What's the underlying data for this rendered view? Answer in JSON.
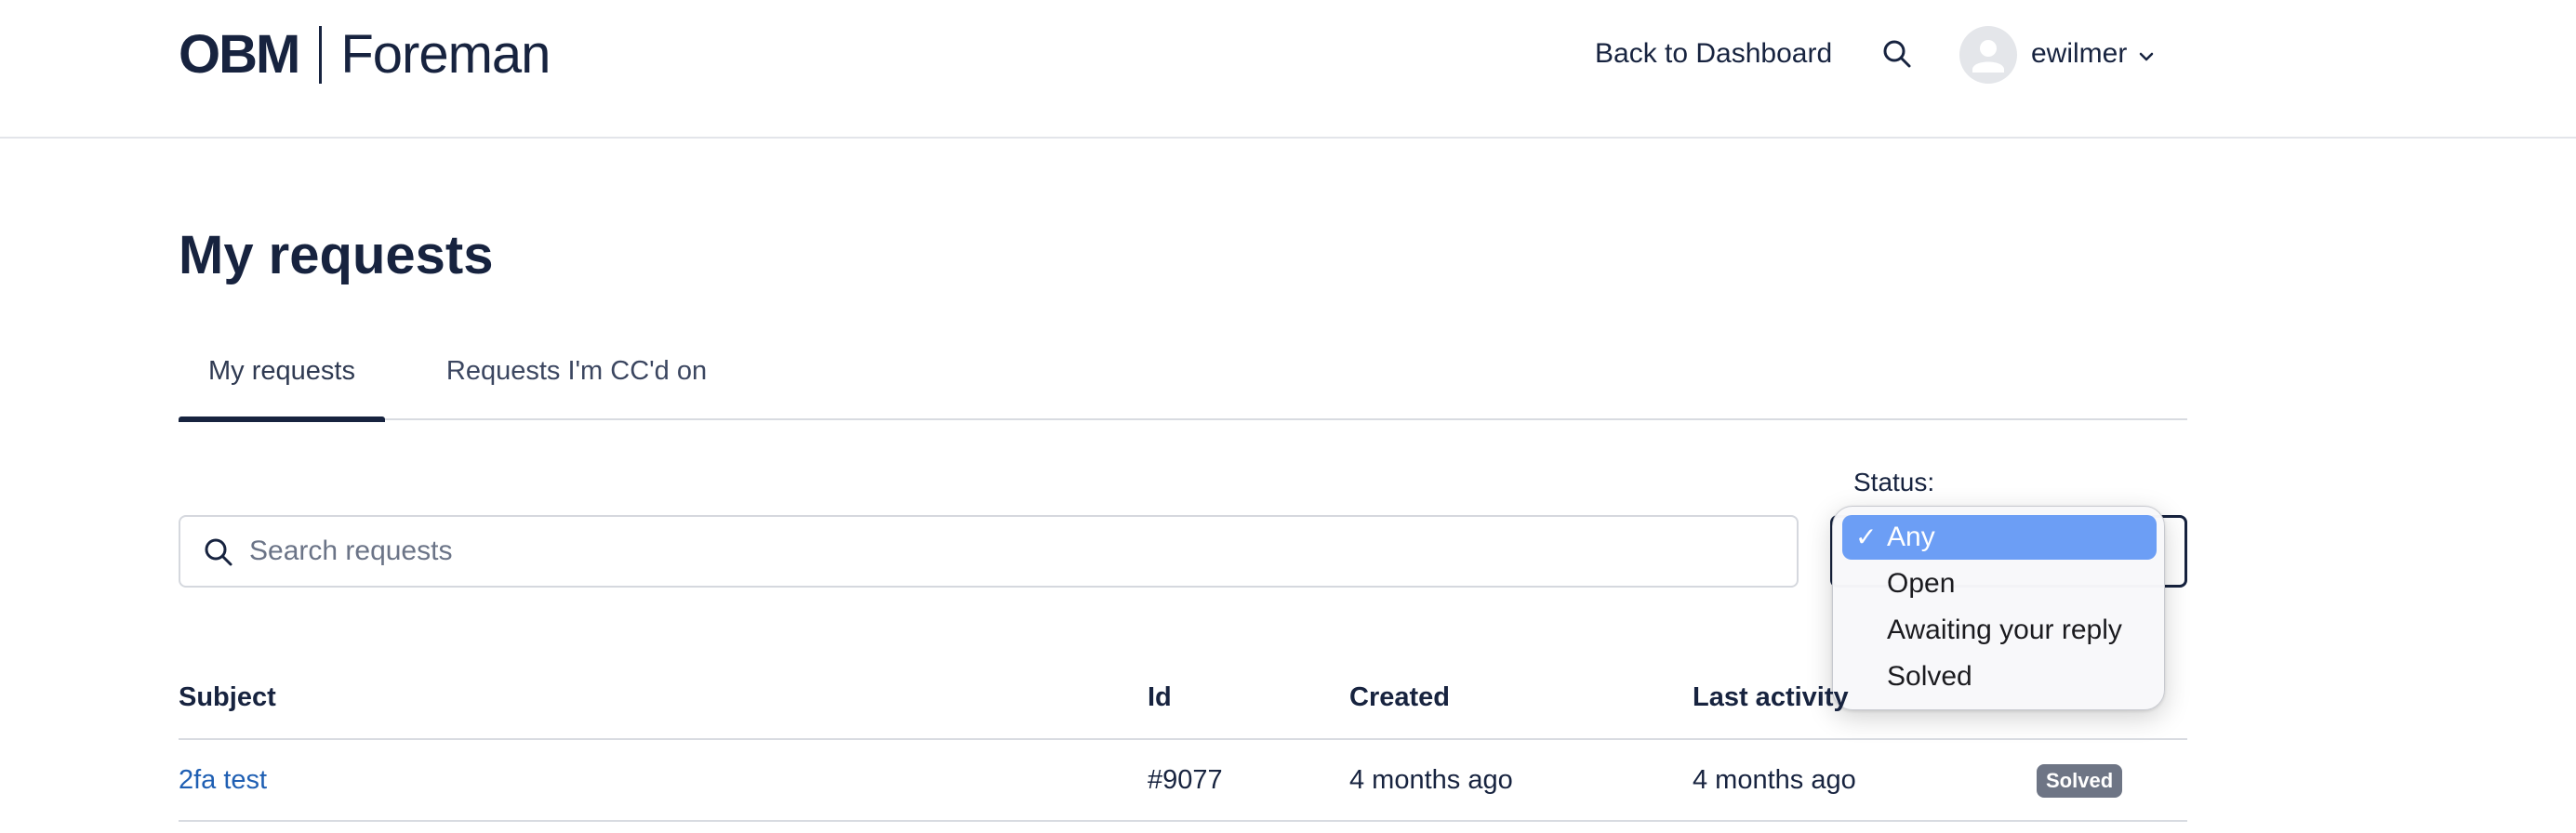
{
  "header": {
    "logo_left": "OBM",
    "logo_right": "Foreman",
    "back_link": "Back to Dashboard",
    "search_icon": "search-icon",
    "avatar_icon": "user-avatar-icon",
    "username": "ewilmer",
    "user_chevron_icon": "chevron-down-icon"
  },
  "page": {
    "title": "My requests"
  },
  "tabs": [
    {
      "label": "My requests",
      "active": true
    },
    {
      "label": "Requests I'm CC'd on",
      "active": false
    }
  ],
  "search": {
    "placeholder": "Search requests",
    "value": ""
  },
  "status_filter": {
    "label": "Status:",
    "selected": "Any",
    "options": [
      {
        "label": "Any",
        "selected": true,
        "check": "✓"
      },
      {
        "label": "Open",
        "selected": false
      },
      {
        "label": "Awaiting your reply",
        "selected": false
      },
      {
        "label": "Solved",
        "selected": false
      }
    ]
  },
  "table": {
    "columns": [
      "Subject",
      "Id",
      "Created",
      "Last activity"
    ],
    "rows": [
      {
        "subject": "2fa test",
        "id": "#9077",
        "created": "4 months ago",
        "last_activity": "4 months ago",
        "status": "Solved"
      }
    ]
  },
  "colors": {
    "primary": "#17233f",
    "link": "#1f5fb3",
    "dropdown_highlight": "#6c9ef5",
    "badge_bg": "#6e7585"
  }
}
